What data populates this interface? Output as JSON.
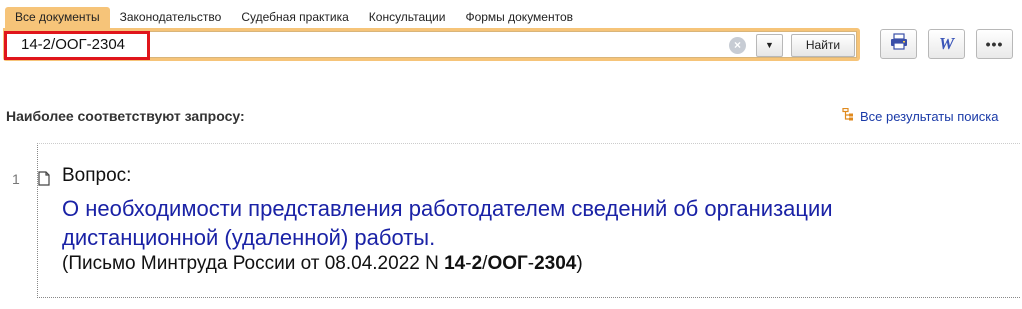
{
  "tabs": [
    {
      "label": "Все документы",
      "active": true
    },
    {
      "label": "Законодательство",
      "active": false
    },
    {
      "label": "Судебная практика",
      "active": false
    },
    {
      "label": "Консультации",
      "active": false
    },
    {
      "label": "Формы документов",
      "active": false
    }
  ],
  "search": {
    "value": "14-2/ООГ-2304",
    "clear_icon": "×",
    "dropdown_icon": "▼",
    "find_label": "Найти"
  },
  "toolbar": {
    "print_icon": "printer-icon",
    "word_glyph": "W",
    "more_glyph": "•••"
  },
  "section": {
    "title": "Наиболее соответствуют запросу:",
    "all_results_label": "Все результаты поиска"
  },
  "result": {
    "number": "1",
    "heading": "Вопрос:",
    "title": "О необходимости представления работодателем сведений об организации дистанционной (удаленной) работы.",
    "source_prefix": "(Письмо Минтруда России от 08.04.2022 N ",
    "source_part_1": "14",
    "source_dash_1": "-",
    "source_part_2": "2",
    "source_slash": "/",
    "source_part_3": "ООГ",
    "source_dash_2": "-",
    "source_part_4": "2304",
    "source_suffix": ")"
  },
  "colors": {
    "tab_active": "#f6c479",
    "highlight": "#e0151b",
    "link": "#1a22a6"
  }
}
